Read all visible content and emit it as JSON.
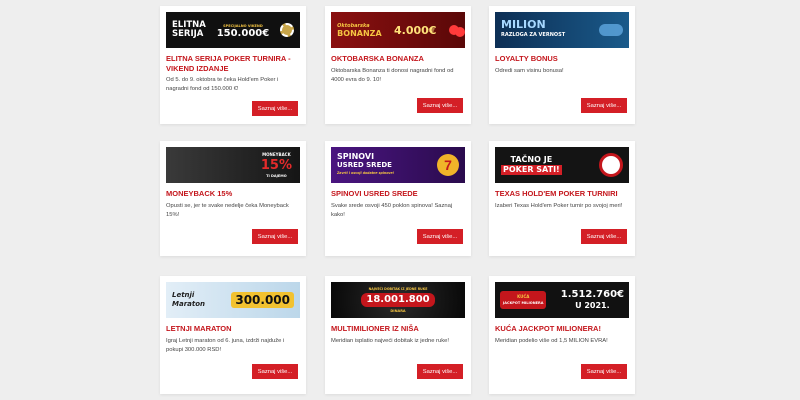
{
  "promotions": [
    {
      "title": "ELITNA SERIJA POKER TURNIRA - VIKEND IZDANJE",
      "description": "Od 5. do 9. oktobra te čeka Hold'em Poker i nagradni fond od 150.000 €!",
      "button": "Saznaj više...",
      "banner": {
        "line1": "ELITNA",
        "line2": "SERIJA",
        "small": "SPECIJALNO VIKEND",
        "amount": "150.000€",
        "bg": "#101010"
      }
    },
    {
      "title": "OKTOBARSKA BONANZA",
      "description": "Oktobarska Bonanza ti donosi nagradni fond od 4000 evra do 9. 10!",
      "button": "Saznaj više...",
      "banner": {
        "line1": "Oktobarska",
        "line2": "BONANZA",
        "amount": "4.000€",
        "bg": "#7a0d0d"
      }
    },
    {
      "title": "LOYALTY BONUS",
      "description": "Odredi sam visinu bonusa!",
      "button": "Saznaj više...",
      "banner": {
        "line1": "MILION",
        "line2": "RAZLOGA ZA VERNOST",
        "bg": "#0b2a4a"
      }
    },
    {
      "title": "MONEYBACK 15%",
      "description": "Opusti se, jer te svake nedelje čeka Moneyback 15%!",
      "button": "Saznaj više...",
      "banner": {
        "small": "MONEYBACK",
        "amount": "15%",
        "line2": "TI DAJEMO",
        "bg": "#1c1c1c"
      }
    },
    {
      "title": "SPINOVI USRED SREDE",
      "description": "Svake srede osvoji 450 poklon spinova! Saznaj kako!",
      "button": "Saznaj više...",
      "banner": {
        "line1": "SPINOVI",
        "line2": "USRED SREDE",
        "small": "Zavrti i osvoji dodatne spinove!",
        "bg": "#3b1166"
      }
    },
    {
      "title": "TEXAS HOLD'EM POKER TURNIRI",
      "description": "Izaberi Texas Hold'em Poker turnir po svojoj meri!",
      "button": "Saznaj više...",
      "banner": {
        "line1": "TAČNO JE",
        "line2": "POKER SATI!",
        "bg": "#141414"
      }
    },
    {
      "title": "LETNJI MARATON",
      "description": "Igraj Letnji maraton od 6. juna, izdrži najduže i pokupi 300.000 RSD!",
      "button": "Saznaj više...",
      "banner": {
        "line1": "Letnji",
        "line2": "Maraton",
        "amount": "300.000",
        "bg": "#cfe4f2"
      }
    },
    {
      "title": "MULTIMILIONER IZ NIŠA",
      "description": "Meridian isplatio najveći dobitak iz jedne ruke!",
      "button": "Saznaj više...",
      "banner": {
        "small": "NAJVEĆI DOBITAK IZ JEDNE RUKE",
        "amount": "18.001.800",
        "line2": "DINARA",
        "bg": "#0f0f0f"
      }
    },
    {
      "title": "KUĆA JACKPOT MILIONERA!",
      "description": "Meridian podelio više od 1,5 MILION EVRA!",
      "button": "Saznaj više...",
      "banner": {
        "line1": "KUĆA",
        "line2": "JACKPOT MILIONERA",
        "amount": "1.512.760€",
        "small": "U 2021.",
        "bg": "#111111"
      }
    }
  ]
}
